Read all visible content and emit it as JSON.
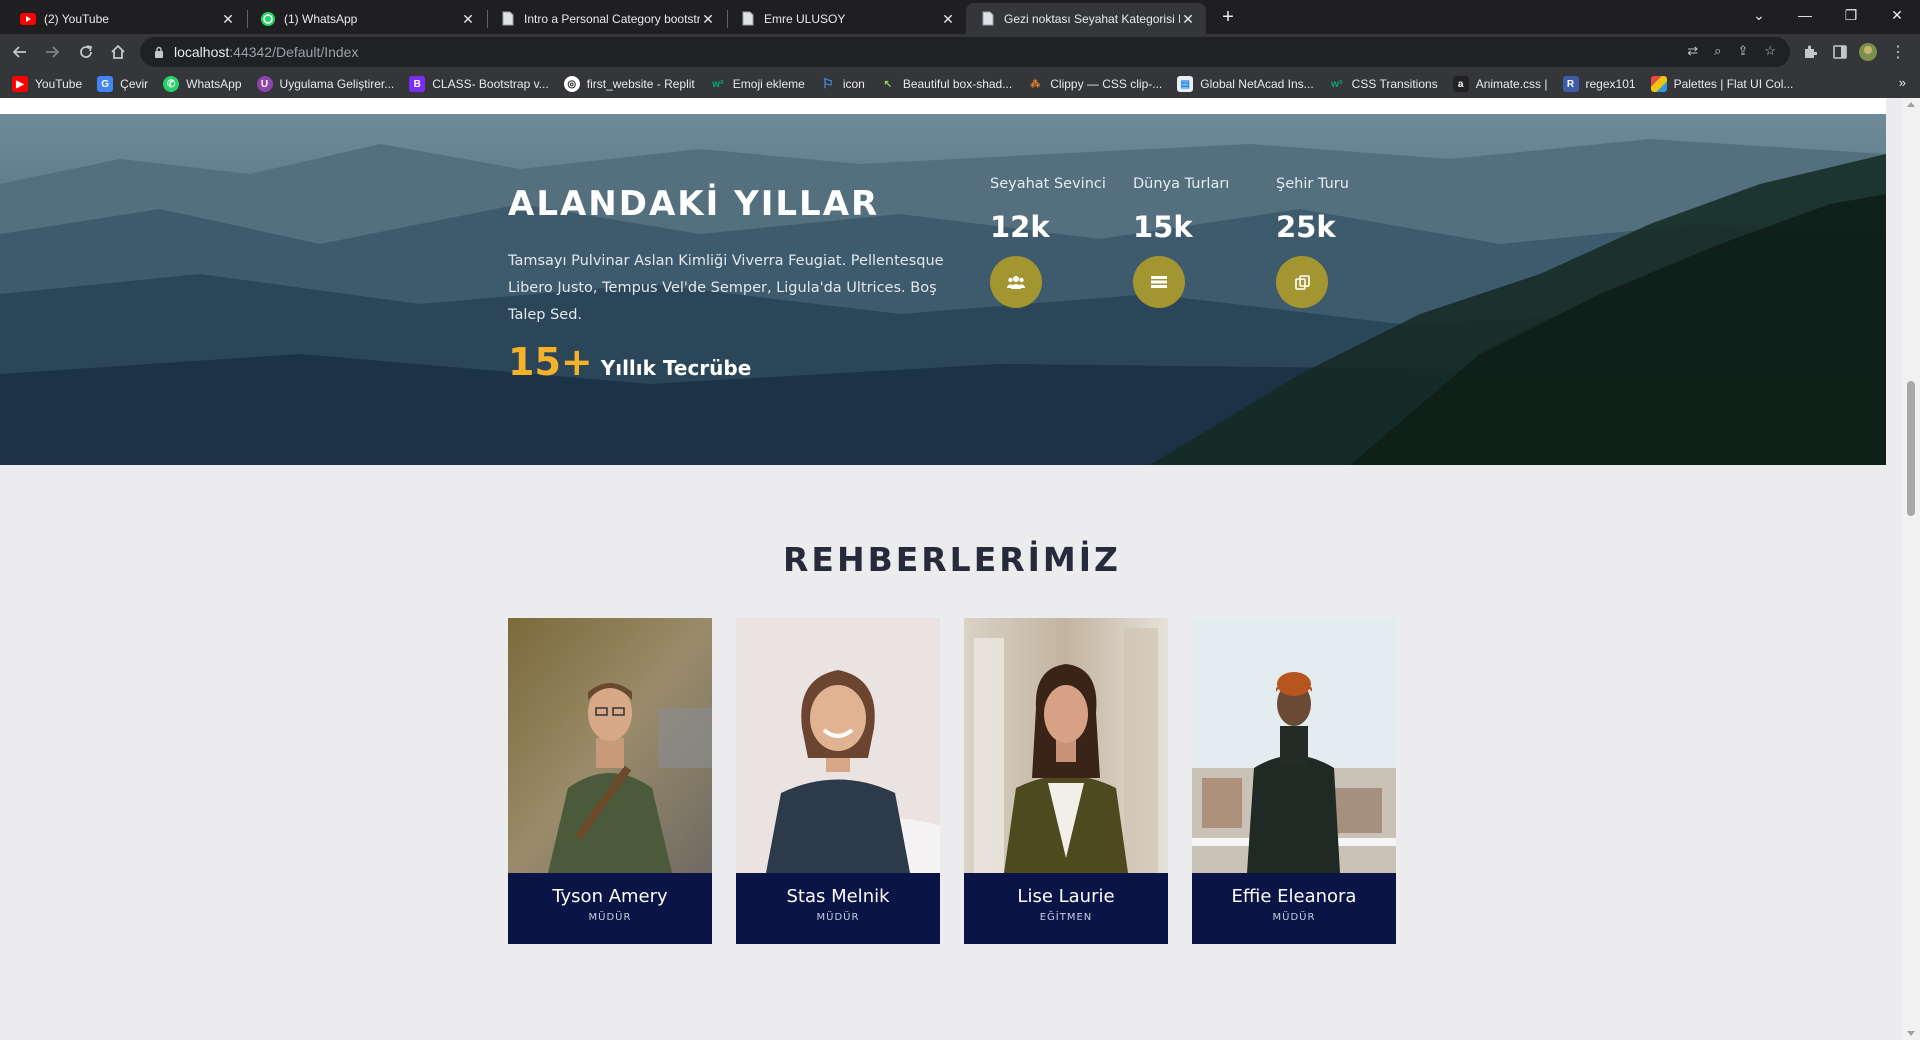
{
  "browser": {
    "tabs": [
      {
        "title": "(2) YouTube",
        "favicon": "youtube-icon",
        "active": false
      },
      {
        "title": "(1) WhatsApp",
        "favicon": "whatsapp-icon",
        "active": false
      },
      {
        "title": "Intro a Personal Category bootstr",
        "favicon": "document-icon",
        "active": false
      },
      {
        "title": "Emre ULUSOY",
        "favicon": "document-icon",
        "active": false
      },
      {
        "title": "Gezi noktası Seyahat Kategorisi D",
        "favicon": "document-icon",
        "active": true
      }
    ],
    "new_tab_label": "+",
    "url_host": "localhost",
    "url_path": ":44342/Default/Index",
    "bookmarks": [
      {
        "label": "YouTube",
        "icon": "youtube-icon",
        "color": "#ff0000"
      },
      {
        "label": "Çevir",
        "icon": "translate-icon",
        "color": "#4285f4"
      },
      {
        "label": "WhatsApp",
        "icon": "whatsapp-icon",
        "color": "#25d366"
      },
      {
        "label": "Uygulama Geliştirer...",
        "icon": "app-dev-icon",
        "color": "#8e44ad"
      },
      {
        "label": "CLASS- Bootstrap v...",
        "icon": "bootstrap-icon",
        "color": "#7b2cf5"
      },
      {
        "label": "first_website - Replit",
        "icon": "replit-icon",
        "color": "#333333"
      },
      {
        "label": "Emoji ekleme",
        "icon": "w3schools-icon",
        "color": "#04aa6d"
      },
      {
        "label": "icon",
        "icon": "flag-icon",
        "color": "#4a90e2"
      },
      {
        "label": "Beautiful box-shad...",
        "icon": "cursor-icon",
        "color": "#2e7d32"
      },
      {
        "label": "Clippy — CSS clip-...",
        "icon": "clippy-icon",
        "color": "#e67e22"
      },
      {
        "label": "Global NetAcad Ins...",
        "icon": "netacad-icon",
        "color": "#1e88e5"
      },
      {
        "label": "CSS Transitions",
        "icon": "w3schools-icon",
        "color": "#04aa6d"
      },
      {
        "label": "Animate.css |",
        "icon": "animate-icon",
        "color": "#222222"
      },
      {
        "label": "regex101",
        "icon": "regex-icon",
        "color": "#3f5ca8"
      },
      {
        "label": "Palettes | Flat UI Col...",
        "icon": "palette-icon",
        "color": "#e74c3c"
      }
    ],
    "more_bookmarks": "»"
  },
  "hero": {
    "title": "ALANDAKİ YILLAR",
    "description": "Tamsayı Pulvinar Aslan Kimliği Viverra Feugiat. Pellentesque Libero Justo, Tempus Vel'de Semper, Ligula'da Ultrices. Boş Talep Sed.",
    "experience_number": "15+",
    "experience_label": "Yıllık Tecrübe",
    "stats": [
      {
        "label": "Seyahat Sevinci",
        "value": "12k",
        "icon": "users-icon"
      },
      {
        "label": "Dünya Turları",
        "value": "15k",
        "icon": "list-icon"
      },
      {
        "label": "Şehir Turu",
        "value": "25k",
        "icon": "copy-icon"
      }
    ],
    "accent_color": "#a39530",
    "highlight_color": "#f3b22a"
  },
  "guides": {
    "title": "REHBERLERİMİZ",
    "cards": [
      {
        "name": "Tyson Amery",
        "role": "MÜDÜR"
      },
      {
        "name": "Stas Melnik",
        "role": "MÜDÜR"
      },
      {
        "name": "Lise Laurie",
        "role": "EĞİTMEN"
      },
      {
        "name": "Effie Eleanora",
        "role": "MÜDÜR"
      }
    ],
    "card_color": "#0a1446"
  }
}
